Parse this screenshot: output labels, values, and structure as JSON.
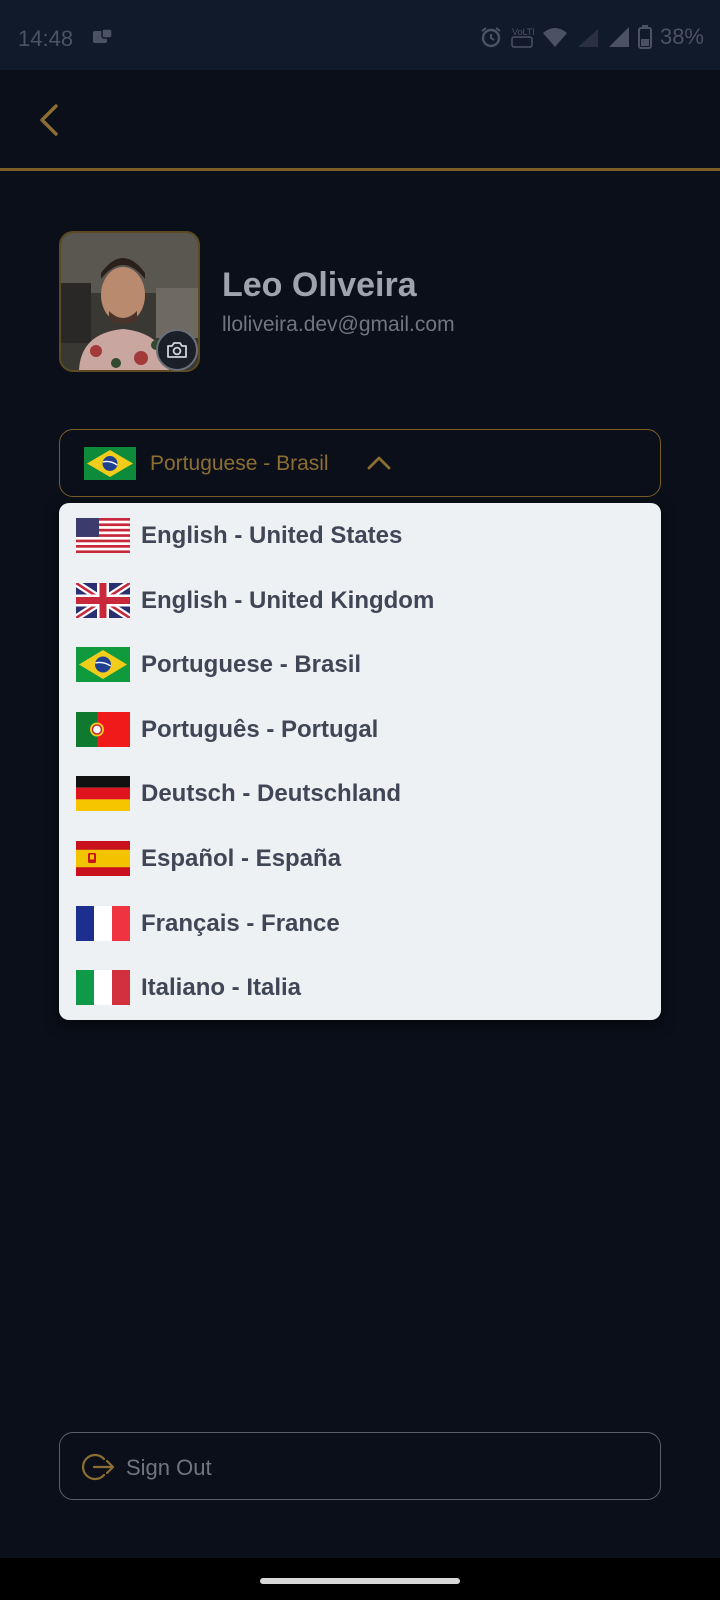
{
  "status_bar": {
    "time": "14:48",
    "battery": "38%"
  },
  "header": {
    "back_icon": "chevron-left-icon"
  },
  "profile": {
    "name": "Leo Oliveira",
    "email": "lloliveira.dev@gmail.com",
    "camera_icon": "camera-icon"
  },
  "language_select": {
    "selected_label": "Portuguese - Brasil",
    "selected_flag": "flag-brazil-icon",
    "expanded": true
  },
  "languages": [
    {
      "label": "English - United States",
      "flag": "flag-us-icon"
    },
    {
      "label": "English - United Kingdom",
      "flag": "flag-uk-icon"
    },
    {
      "label": "Portuguese - Brasil",
      "flag": "flag-brazil-icon"
    },
    {
      "label": "Português - Portugal",
      "flag": "flag-portugal-icon"
    },
    {
      "label": "Deutsch - Deutschland",
      "flag": "flag-germany-icon"
    },
    {
      "label": "Español - España",
      "flag": "flag-spain-icon"
    },
    {
      "label": "Français - France",
      "flag": "flag-france-icon"
    },
    {
      "label": "Italiano - Italia",
      "flag": "flag-italy-icon"
    }
  ],
  "sign_out": {
    "label": "Sign Out"
  },
  "colors": {
    "background": "#0b0f19",
    "accent_gold": "#8c6e33",
    "dropdown_bg": "#eef1f4",
    "item_text": "#404656"
  }
}
